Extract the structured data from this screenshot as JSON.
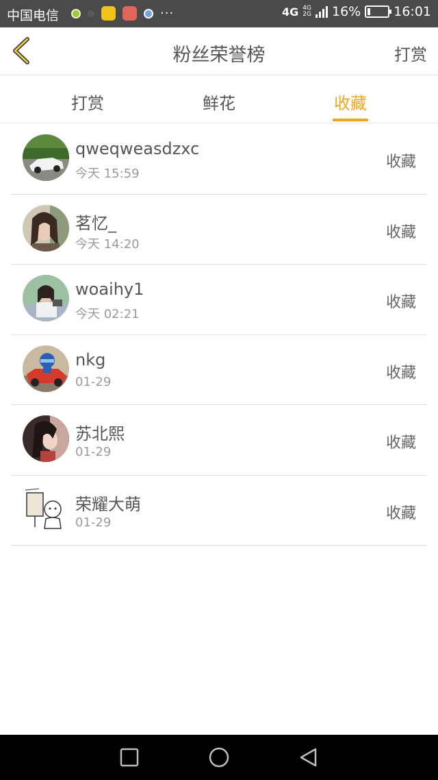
{
  "status_bar": {
    "carrier": "中国电信",
    "more": "···",
    "network": "4G",
    "network_small_top": "4G",
    "network_small_bottom": "2G",
    "battery": "16%",
    "battery_level": 0.16,
    "time": "16:01"
  },
  "header": {
    "back_icon": "chevron-left-icon",
    "title": "粉丝荣誉榜",
    "action": "打赏"
  },
  "tabs": [
    {
      "label": "打赏",
      "active": false
    },
    {
      "label": "鲜花",
      "active": false
    },
    {
      "label": "收藏",
      "active": true
    }
  ],
  "accent_color": "#f4a623",
  "fans": [
    {
      "name": "qweqweasdzxc",
      "time": "今天 15:59",
      "action": "收藏"
    },
    {
      "name": "茗忆_",
      "time": "今天 14:20",
      "action": "收藏"
    },
    {
      "name": "woaihy1",
      "time": "今天 02:21",
      "action": "收藏"
    },
    {
      "name": "nkg",
      "time": "01-29",
      "action": "收藏"
    },
    {
      "name": "苏北熙",
      "time": "01-29",
      "action": "收藏"
    },
    {
      "name": "荣耀大萌",
      "time": "01-29",
      "action": "收藏"
    }
  ],
  "nav_bar": {
    "recent_icon": "square-icon",
    "home_icon": "circle-icon",
    "back_icon": "triangle-back-icon"
  }
}
